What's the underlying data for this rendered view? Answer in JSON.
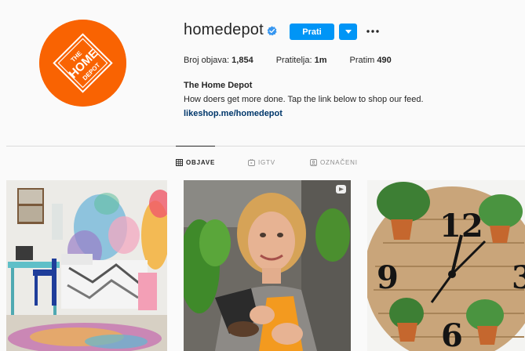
{
  "profile": {
    "avatar_logo_text": "THE HOME DEPOT",
    "username": "homedepot",
    "verified_icon": "verified-badge-icon",
    "follow_label": "Prati",
    "stats": {
      "posts_label": "Broj objava:",
      "posts_value": "1,854",
      "followers_label": "Pratitelja:",
      "followers_value": "1m",
      "following_label": "Pratim",
      "following_value": "490"
    },
    "full_name": "The Home Depot",
    "bio": "How doers get more done. Tap the link below to shop our feed.",
    "link": "likeshop.me/homedepot"
  },
  "tabs": [
    {
      "label": "OBJAVE",
      "icon": "grid-icon",
      "active": true
    },
    {
      "label": "IGTV",
      "icon": "igtv-icon",
      "active": false
    },
    {
      "label": "OZNAČENI",
      "icon": "tagged-icon",
      "active": false
    }
  ],
  "colors": {
    "brand_orange": "#f96302",
    "button_blue": "#0095f6",
    "link_blue": "#00376b"
  }
}
